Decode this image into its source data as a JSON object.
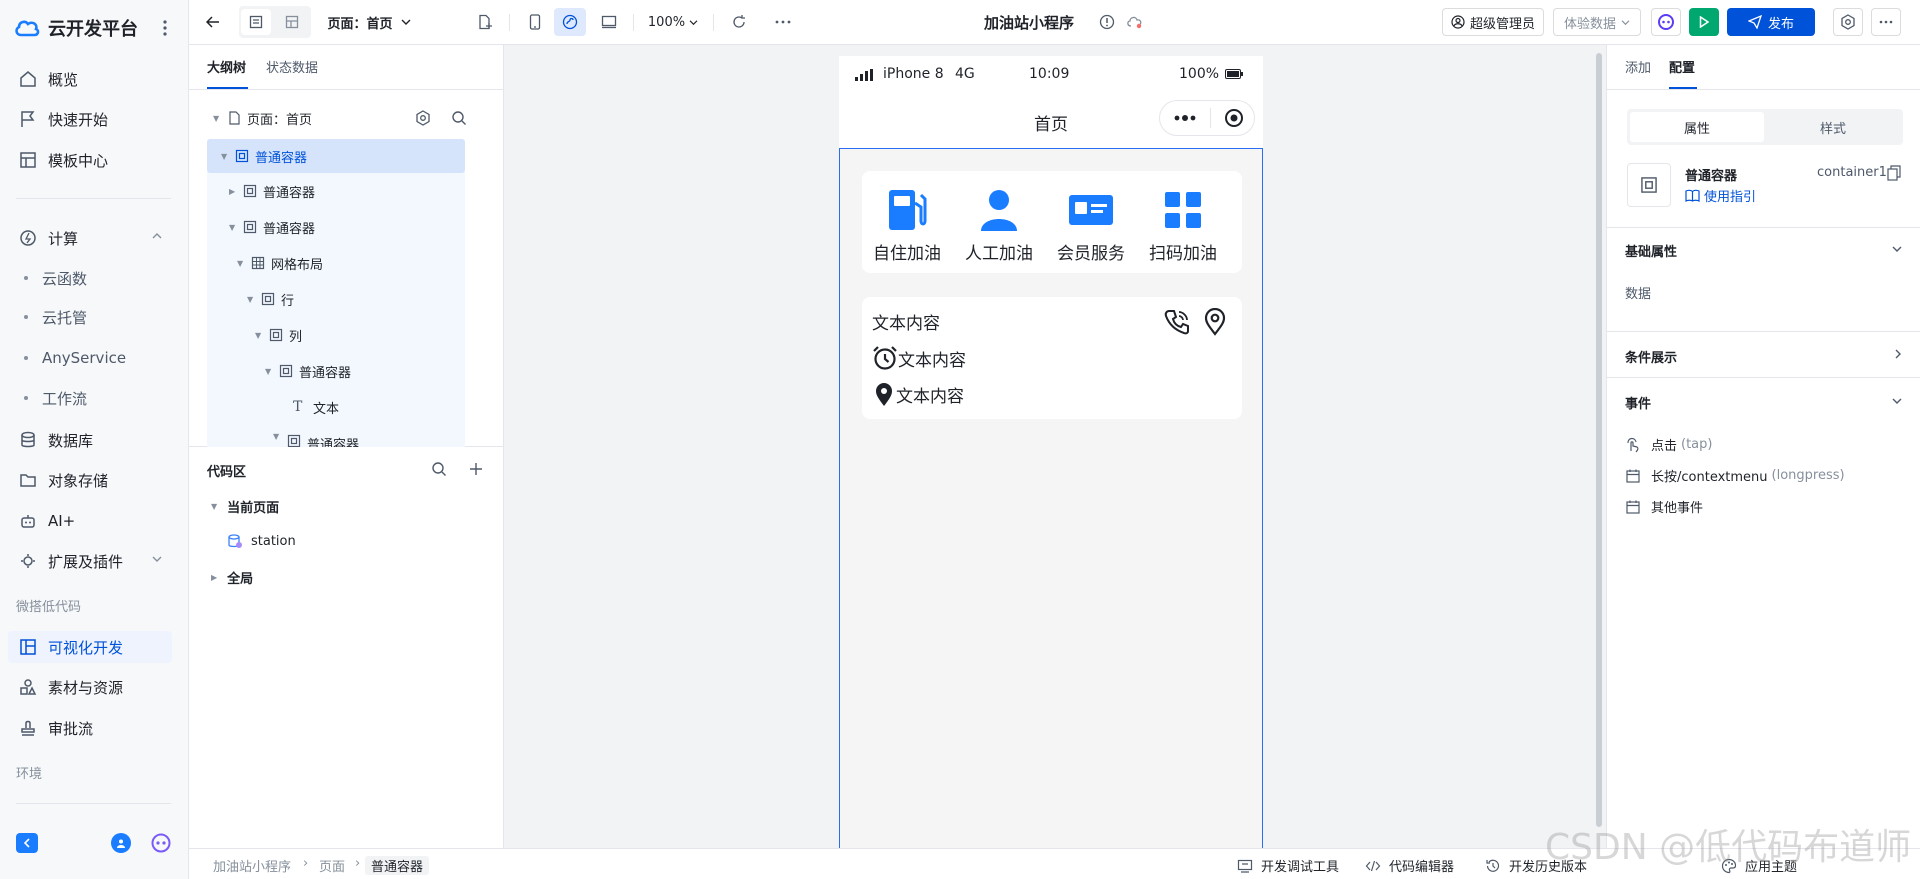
{
  "brand": {
    "name": "云开发平台"
  },
  "nav": {
    "overview": "概览",
    "quickstart": "快速开始",
    "templates": "模板中心",
    "compute": "计算",
    "compute_items": [
      "云函数",
      "云托管",
      "AnyService",
      "工作流"
    ],
    "database": "数据库",
    "storage": "对象存储",
    "ai": "AI+",
    "extensions": "扩展及插件",
    "lowcode_section": "微搭低代码",
    "visual_dev": "可视化开发",
    "assets": "素材与资源",
    "approval": "审批流",
    "env_section": "环境"
  },
  "toolbar": {
    "page_selector": "页面：首页",
    "zoom": "100%",
    "app_title": "加油站小程序",
    "admin": "超级管理员",
    "data_mode": "体验数据",
    "publish": "发布"
  },
  "outline": {
    "tabs": [
      "大纲树",
      "状态数据"
    ],
    "page_node": "页面：首页",
    "nodes": [
      "普通容器",
      "普通容器",
      "普通容器",
      "网格布局",
      "行",
      "列",
      "普通容器",
      "文本",
      "普通容器"
    ]
  },
  "code": {
    "title": "代码区",
    "current_page": "当前页面",
    "item": "station",
    "global": "全局"
  },
  "phone": {
    "device": "iPhone 8",
    "network": "4G",
    "time": "10:09",
    "battery": "100%",
    "page_title": "首页",
    "services": [
      "自住加油",
      "人工加油",
      "会员服务",
      "扫码加油"
    ],
    "info_title": "文本内容",
    "info_line1": "文本内容",
    "info_line2": "文本内容"
  },
  "right": {
    "tabs": [
      "添加",
      "配置"
    ],
    "seg": [
      "属性",
      "样式"
    ],
    "component_name": "普通容器",
    "component_id": "container1",
    "guide": "使用指引",
    "basic_props": "基础属性",
    "data_label": "数据",
    "condition": "条件展示",
    "events": "事件",
    "event_items": [
      {
        "label": "点击",
        "hint": "(tap)"
      },
      {
        "label": "长按/contextmenu",
        "hint": "(longpress)"
      },
      {
        "label": "其他事件",
        "hint": ""
      }
    ]
  },
  "bottom": {
    "crumbs": [
      "加油站小程序",
      "页面",
      "普通容器"
    ],
    "debug": "开发调试工具",
    "code_editor": "代码编辑器",
    "history": "开发历史版本",
    "theme": "应用主题"
  },
  "watermark": "CSDN @低代码布道师",
  "colors": {
    "primary": "#0052d9",
    "accent": "#1a7cff",
    "run": "#00a870",
    "canvas_border": "#2a6df4"
  }
}
